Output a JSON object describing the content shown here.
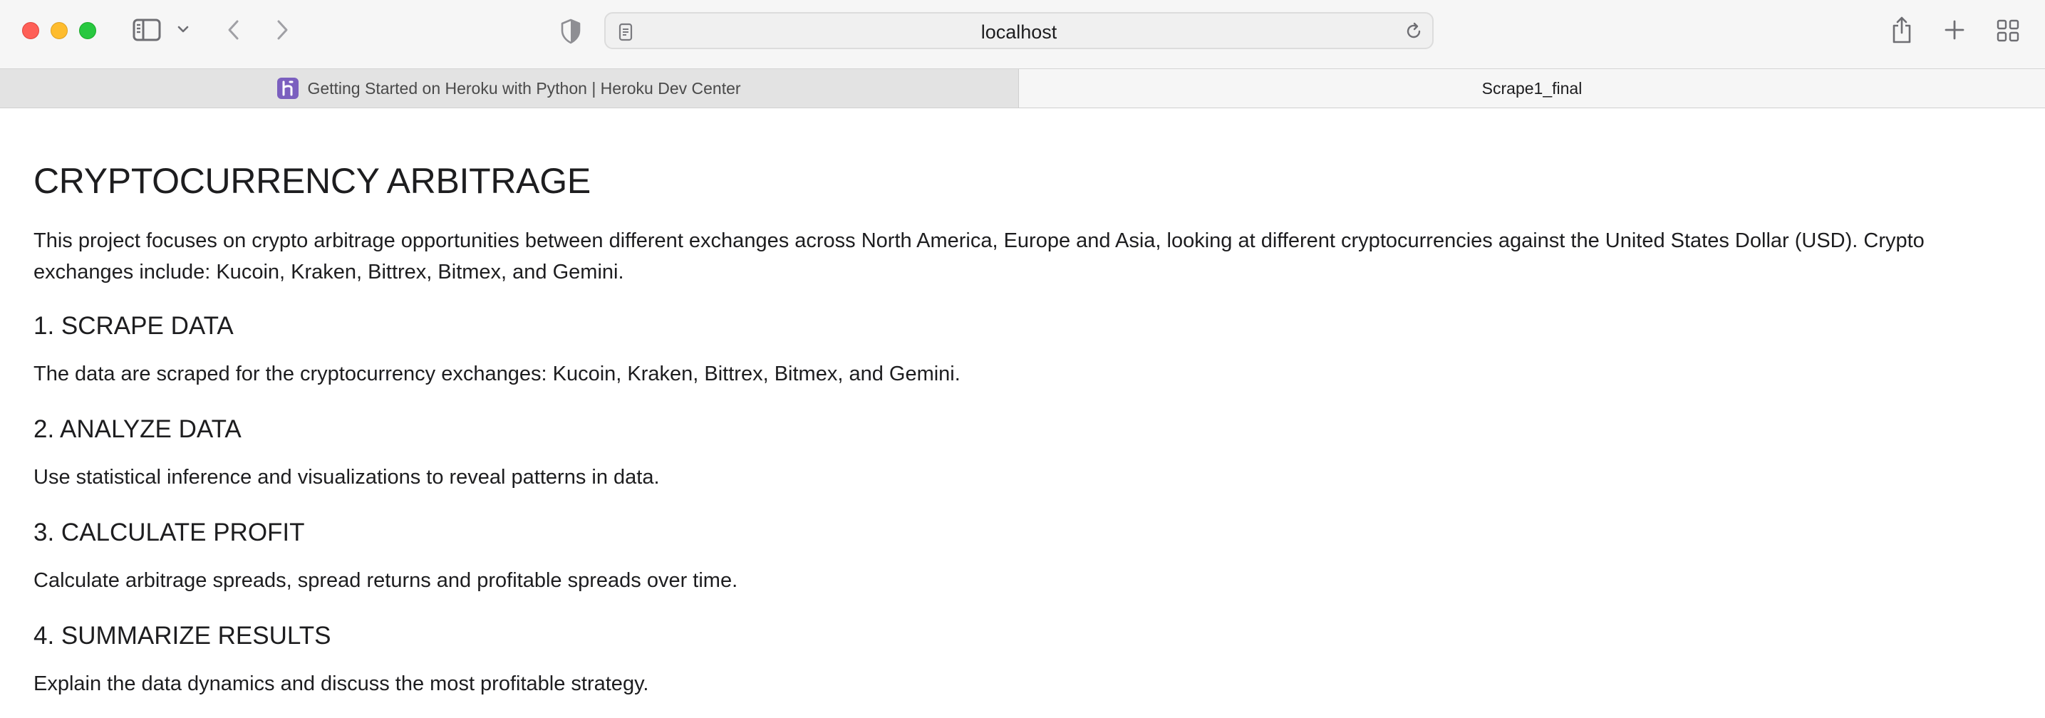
{
  "browser": {
    "url": "localhost",
    "tabs": [
      {
        "label": "Getting Started on Heroku with Python | Heroku Dev Center",
        "active": false,
        "favicon": "heroku-icon"
      },
      {
        "label": "Scrape1_final",
        "active": true
      }
    ],
    "icons": {
      "sidebar": "sidebar-icon",
      "sidebar_menu": "chevron-down-icon",
      "back": "chevron-left-icon",
      "forward": "chevron-right-icon",
      "privacy": "shield-icon",
      "page": "page-icon",
      "reload": "reload-icon",
      "share": "share-icon",
      "new_tab": "plus-icon",
      "tab_overview": "grid-icon"
    },
    "colors": {
      "close": "#fe5f57",
      "minimize": "#febc2e",
      "maximize": "#28c840",
      "heroku_favicon": "#7b5fbf"
    }
  },
  "page": {
    "title": "CRYPTOCURRENCY ARBITRAGE",
    "intro": "This project focuses on crypto arbitrage opportunities between different exchanges across North America, Europe and Asia, looking at different cryptocurrencies against the United States Dollar (USD). Crypto exchanges include: Kucoin, Kraken, Bittrex, Bitmex, and Gemini.",
    "sections": [
      {
        "heading": "1. SCRAPE DATA",
        "text": "The data are scraped for the cryptocurrency exchanges: Kucoin, Kraken, Bittrex, Bitmex, and Gemini."
      },
      {
        "heading": "2. ANALYZE DATA",
        "text": "Use statistical inference and visualizations to reveal patterns in data."
      },
      {
        "heading": "3. CALCULATE PROFIT",
        "text": "Calculate arbitrage spreads, spread returns and profitable spreads over time."
      },
      {
        "heading": "4. SUMMARIZE RESULTS",
        "text": "Explain the data dynamics and discuss the most profitable strategy."
      }
    ]
  }
}
